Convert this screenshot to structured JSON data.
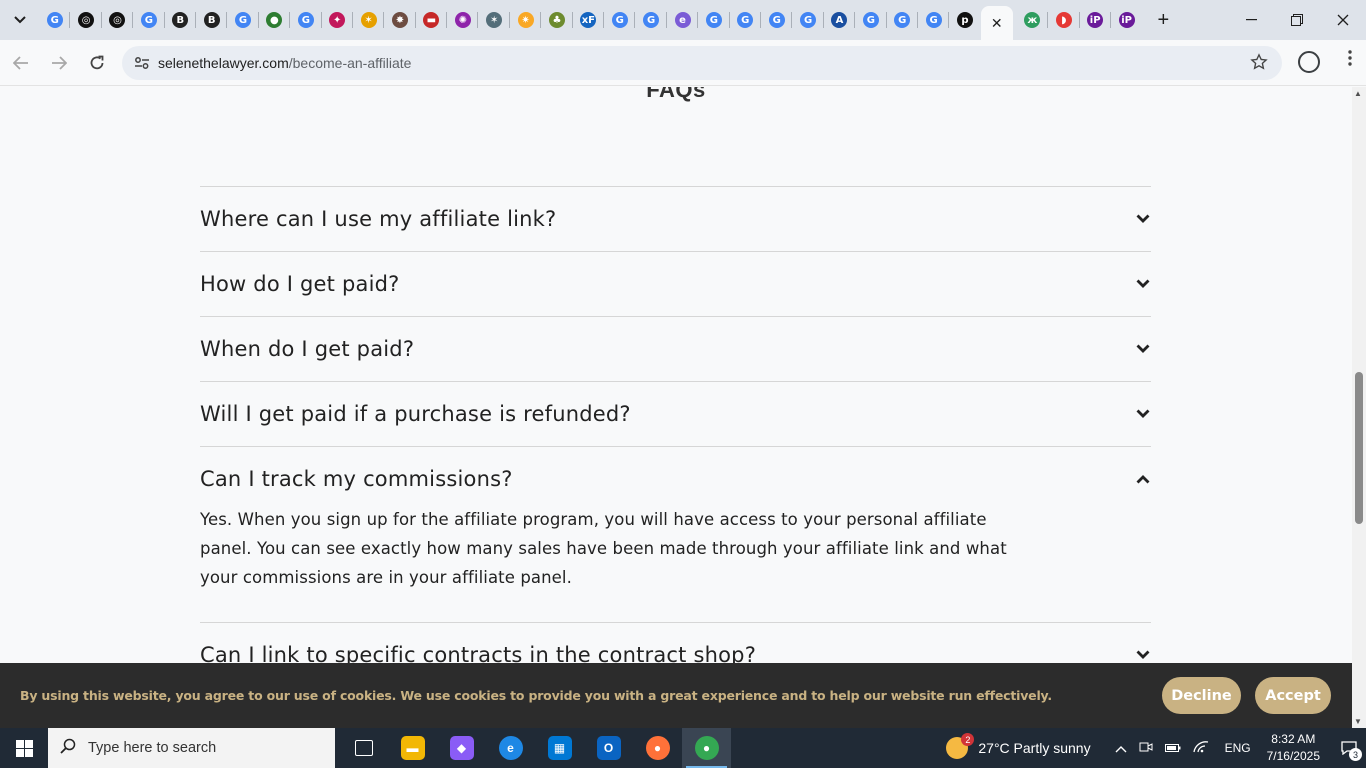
{
  "browser": {
    "tabs": [
      {
        "icon": "google-icon",
        "glyph": "G",
        "color": "#4285f4"
      },
      {
        "icon": "openai-icon",
        "glyph": "◎",
        "color": "#111111"
      },
      {
        "icon": "openai-icon",
        "glyph": "◎",
        "color": "#111111"
      },
      {
        "icon": "google-icon",
        "glyph": "G",
        "color": "#4285f4"
      },
      {
        "icon": "book-icon",
        "glyph": "B",
        "color": "#222222"
      },
      {
        "icon": "book-icon",
        "glyph": "B",
        "color": "#222222"
      },
      {
        "icon": "google-icon",
        "glyph": "G",
        "color": "#4285f4"
      },
      {
        "icon": "globe-green-icon",
        "glyph": "●",
        "color": "#2e7d32"
      },
      {
        "icon": "google-icon",
        "glyph": "G",
        "color": "#4285f4"
      },
      {
        "icon": "compass-icon",
        "glyph": "✦",
        "color": "#c2185b"
      },
      {
        "icon": "figure-icon",
        "glyph": "✶",
        "color": "#e6a000"
      },
      {
        "icon": "puzzle-icon",
        "glyph": "✸",
        "color": "#6d4c41"
      },
      {
        "icon": "dash-icon",
        "glyph": "▬",
        "color": "#c62828"
      },
      {
        "icon": "swirl-icon",
        "glyph": "✺",
        "color": "#8e24aa"
      },
      {
        "icon": "figure-icon",
        "glyph": "✶",
        "color": "#546e7a"
      },
      {
        "icon": "sparkle-icon",
        "glyph": "✷",
        "color": "#f9a825"
      },
      {
        "icon": "pineapple-icon",
        "glyph": "♣",
        "color": "#6d8b2f"
      },
      {
        "icon": "xf-icon",
        "glyph": "xF",
        "color": "#1565c0"
      },
      {
        "icon": "google-icon",
        "glyph": "G",
        "color": "#4285f4"
      },
      {
        "icon": "google-icon",
        "glyph": "G",
        "color": "#4285f4"
      },
      {
        "icon": "edge-circle-icon",
        "glyph": "e",
        "color": "#7b5cd6"
      },
      {
        "icon": "google-icon",
        "glyph": "G",
        "color": "#4285f4"
      },
      {
        "icon": "google-icon",
        "glyph": "G",
        "color": "#4285f4"
      },
      {
        "icon": "google-icon",
        "glyph": "G",
        "color": "#4285f4"
      },
      {
        "icon": "google-icon",
        "glyph": "G",
        "color": "#4285f4"
      },
      {
        "icon": "signature-icon",
        "glyph": "A",
        "color": "#1a4fa0"
      },
      {
        "icon": "google-icon",
        "glyph": "G",
        "color": "#4285f4"
      },
      {
        "icon": "google-icon",
        "glyph": "G",
        "color": "#4285f4"
      },
      {
        "icon": "google-icon",
        "glyph": "G",
        "color": "#4285f4"
      },
      {
        "icon": "p-circle-icon",
        "glyph": "p",
        "color": "#111111"
      }
    ],
    "tabs_after": [
      {
        "icon": "butterfly-icon",
        "glyph": "ж",
        "color": "#2e9d5f"
      },
      {
        "icon": "pocket-icon",
        "glyph": "◗",
        "color": "#e53935"
      },
      {
        "icon": "ip-icon",
        "glyph": "iP",
        "color": "#6a1b9a"
      },
      {
        "icon": "ip-icon",
        "glyph": "iP",
        "color": "#6a1b9a"
      }
    ],
    "active_tab_close": "✕",
    "new_tab": "+",
    "url_host": "selenethelawyer.com",
    "url_path": "/become-an-affiliate"
  },
  "page": {
    "heading": "FAQs",
    "faqs": [
      {
        "question": "Where can I use my affiliate link?",
        "expanded": false
      },
      {
        "question": "How do I get paid?",
        "expanded": false
      },
      {
        "question": "When do I get paid?",
        "expanded": false
      },
      {
        "question": "Will I get paid if a purchase is refunded?",
        "expanded": false
      },
      {
        "question": "Can I track my commissions?",
        "expanded": true,
        "answer": "Yes. When you sign up for the affiliate program, you will have access to your personal affiliate panel. You can see exactly how many sales have been made through your affiliate link and what your commissions are in your affiliate panel."
      },
      {
        "question": "Can I link to specific contracts in the contract shop?",
        "expanded": false
      }
    ]
  },
  "cookie_banner": {
    "text": "By using this website, you agree to our use of cookies. We use cookies to provide you with a great experience and to help our website run effectively.",
    "decline": "Decline",
    "accept": "Accept",
    "accent": "#c9b283"
  },
  "taskbar": {
    "search_placeholder": "Type here to search",
    "apps": [
      {
        "name": "task-view-icon",
        "glyph": "⧉",
        "color": "#202a36"
      },
      {
        "name": "file-explorer-icon",
        "glyph": "▬",
        "color": "#f2b705"
      },
      {
        "name": "copilot-icon",
        "glyph": "◆",
        "color": "#8a5cf6"
      },
      {
        "name": "edge-icon",
        "glyph": "e",
        "color": "#1e88e5"
      },
      {
        "name": "store-icon",
        "glyph": "▦",
        "color": "#0078d4"
      },
      {
        "name": "outlook-icon",
        "glyph": "O",
        "color": "#0a64c2"
      },
      {
        "name": "firefox-icon",
        "glyph": "●",
        "color": "#ff7139"
      },
      {
        "name": "chrome-icon",
        "glyph": "●",
        "color": "#34a853"
      }
    ],
    "weather_badge": "2",
    "weather": "27°C  Partly sunny",
    "language": "ENG",
    "time": "8:32 AM",
    "date": "7/16/2025",
    "notifications": "3"
  }
}
